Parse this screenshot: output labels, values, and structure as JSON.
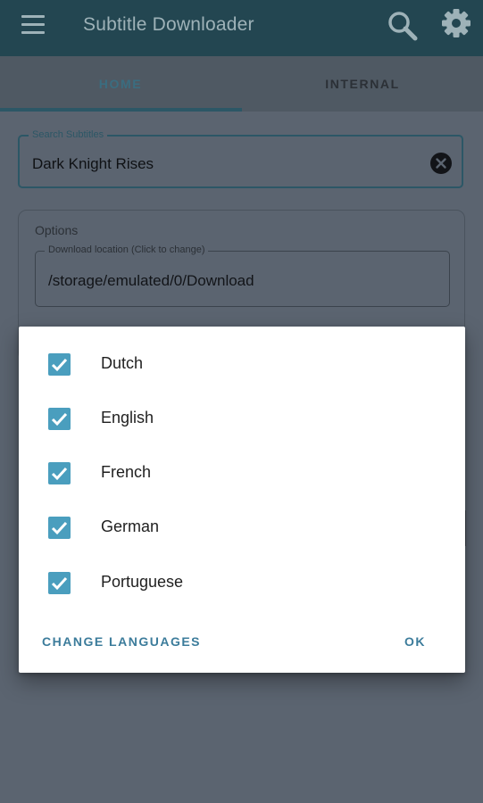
{
  "appbar": {
    "title": "Subtitle Downloader",
    "icons": {
      "menu": "menu-icon",
      "search": "search-icon",
      "settings": "gear-icon"
    },
    "colors": {
      "background": "#234651",
      "foreground": "#9eb2b8"
    }
  },
  "tabs": [
    {
      "label": "HOME",
      "selected": true
    },
    {
      "label": "INTERNAL",
      "selected": false
    }
  ],
  "search": {
    "legend": "Search Subtitles",
    "value": "Dark Knight Rises",
    "clear_icon": "close-circle-icon"
  },
  "options": {
    "title": "Options",
    "location_legend": "Download location (Click to change)",
    "location_value": "/storage/emulated/0/Download"
  },
  "dialog": {
    "languages": [
      {
        "label": "Dutch",
        "checked": true
      },
      {
        "label": "English",
        "checked": true
      },
      {
        "label": "French",
        "checked": true
      },
      {
        "label": "German",
        "checked": true
      },
      {
        "label": "Portuguese",
        "checked": true
      }
    ],
    "change_label": "CHANGE LANGUAGES",
    "ok_label": "OK",
    "accent_color": "#4a9ebe"
  }
}
